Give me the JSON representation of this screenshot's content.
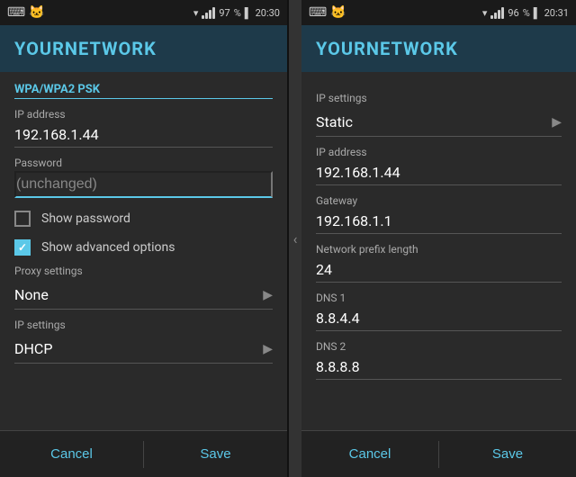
{
  "left_panel": {
    "status": {
      "time": "20:30",
      "battery": "97",
      "wifi": true
    },
    "title": "YOURNETWORK",
    "section": "WPA/WPA2 PSK",
    "ip_label": "IP address",
    "ip_value": "192.168.1.44",
    "password_label": "Password",
    "password_placeholder": "(unchanged)",
    "show_password_label": "Show password",
    "show_advanced_label": "Show advanced options",
    "show_advanced_checked": true,
    "proxy_label": "Proxy settings",
    "proxy_value": "None",
    "ip_settings_label": "IP settings",
    "ip_settings_value": "DHCP",
    "cancel_label": "Cancel",
    "save_label": "Save"
  },
  "right_panel": {
    "status": {
      "time": "20:31",
      "battery": "96",
      "wifi": true
    },
    "title": "YOURNETWORK",
    "ip_settings_label": "IP settings",
    "ip_settings_value": "Static",
    "ip_address_label": "IP address",
    "ip_address_value": "192.168.1.44",
    "gateway_label": "Gateway",
    "gateway_value": "192.168.1.1",
    "prefix_label": "Network prefix length",
    "prefix_value": "24",
    "dns1_label": "DNS 1",
    "dns1_value": "8.8.4.4",
    "dns2_label": "DNS 2",
    "dns2_value": "8.8.8.8",
    "cancel_label": "Cancel",
    "save_label": "Save"
  }
}
